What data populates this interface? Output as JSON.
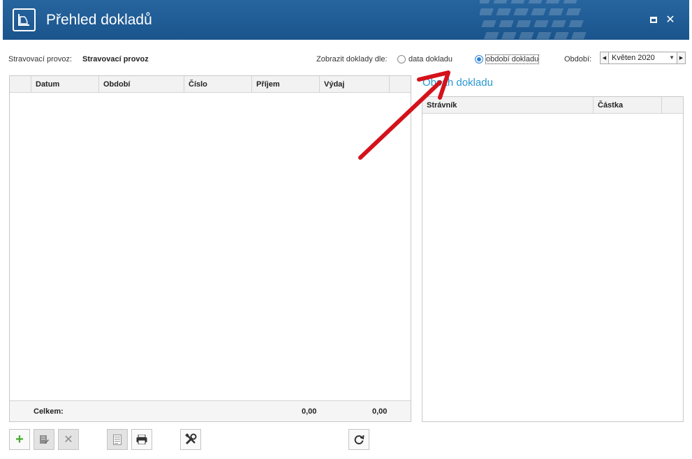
{
  "window": {
    "title": "Přehled dokladů",
    "icon": "document-chart-icon",
    "buttons": [
      "maximize-icon",
      "close-icon"
    ]
  },
  "filter": {
    "provoz_label": "Stravovací provoz:",
    "provoz_value": "Stravovací provoz",
    "show_label": "Zobrazit doklady dle:",
    "radio_date": "data dokladu",
    "radio_period": "období dokladu",
    "selected": "období dokladu",
    "period_label": "Období:",
    "period_value": "Květen 2020"
  },
  "left_grid": {
    "columns": [
      "Datum",
      "Období",
      "Číslo",
      "Příjem",
      "Výdaj"
    ],
    "rows": [],
    "footer": {
      "label": "Celkem:",
      "prijem": "0,00",
      "vydaj": "0,00"
    }
  },
  "right_panel": {
    "title": "Obsah dokladu",
    "columns": [
      "Strávník",
      "Částka"
    ],
    "rows": []
  },
  "toolbar": {
    "buttons": [
      "add-icon",
      "edit-icon",
      "delete-icon",
      "document-icon",
      "print-icon",
      "tools-icon",
      "refresh-icon"
    ]
  },
  "colors": {
    "titlebar": "#1f5b94",
    "accent": "#2a96d0",
    "annotation_arrow": "#d4121b",
    "add_green": "#3fae29"
  }
}
